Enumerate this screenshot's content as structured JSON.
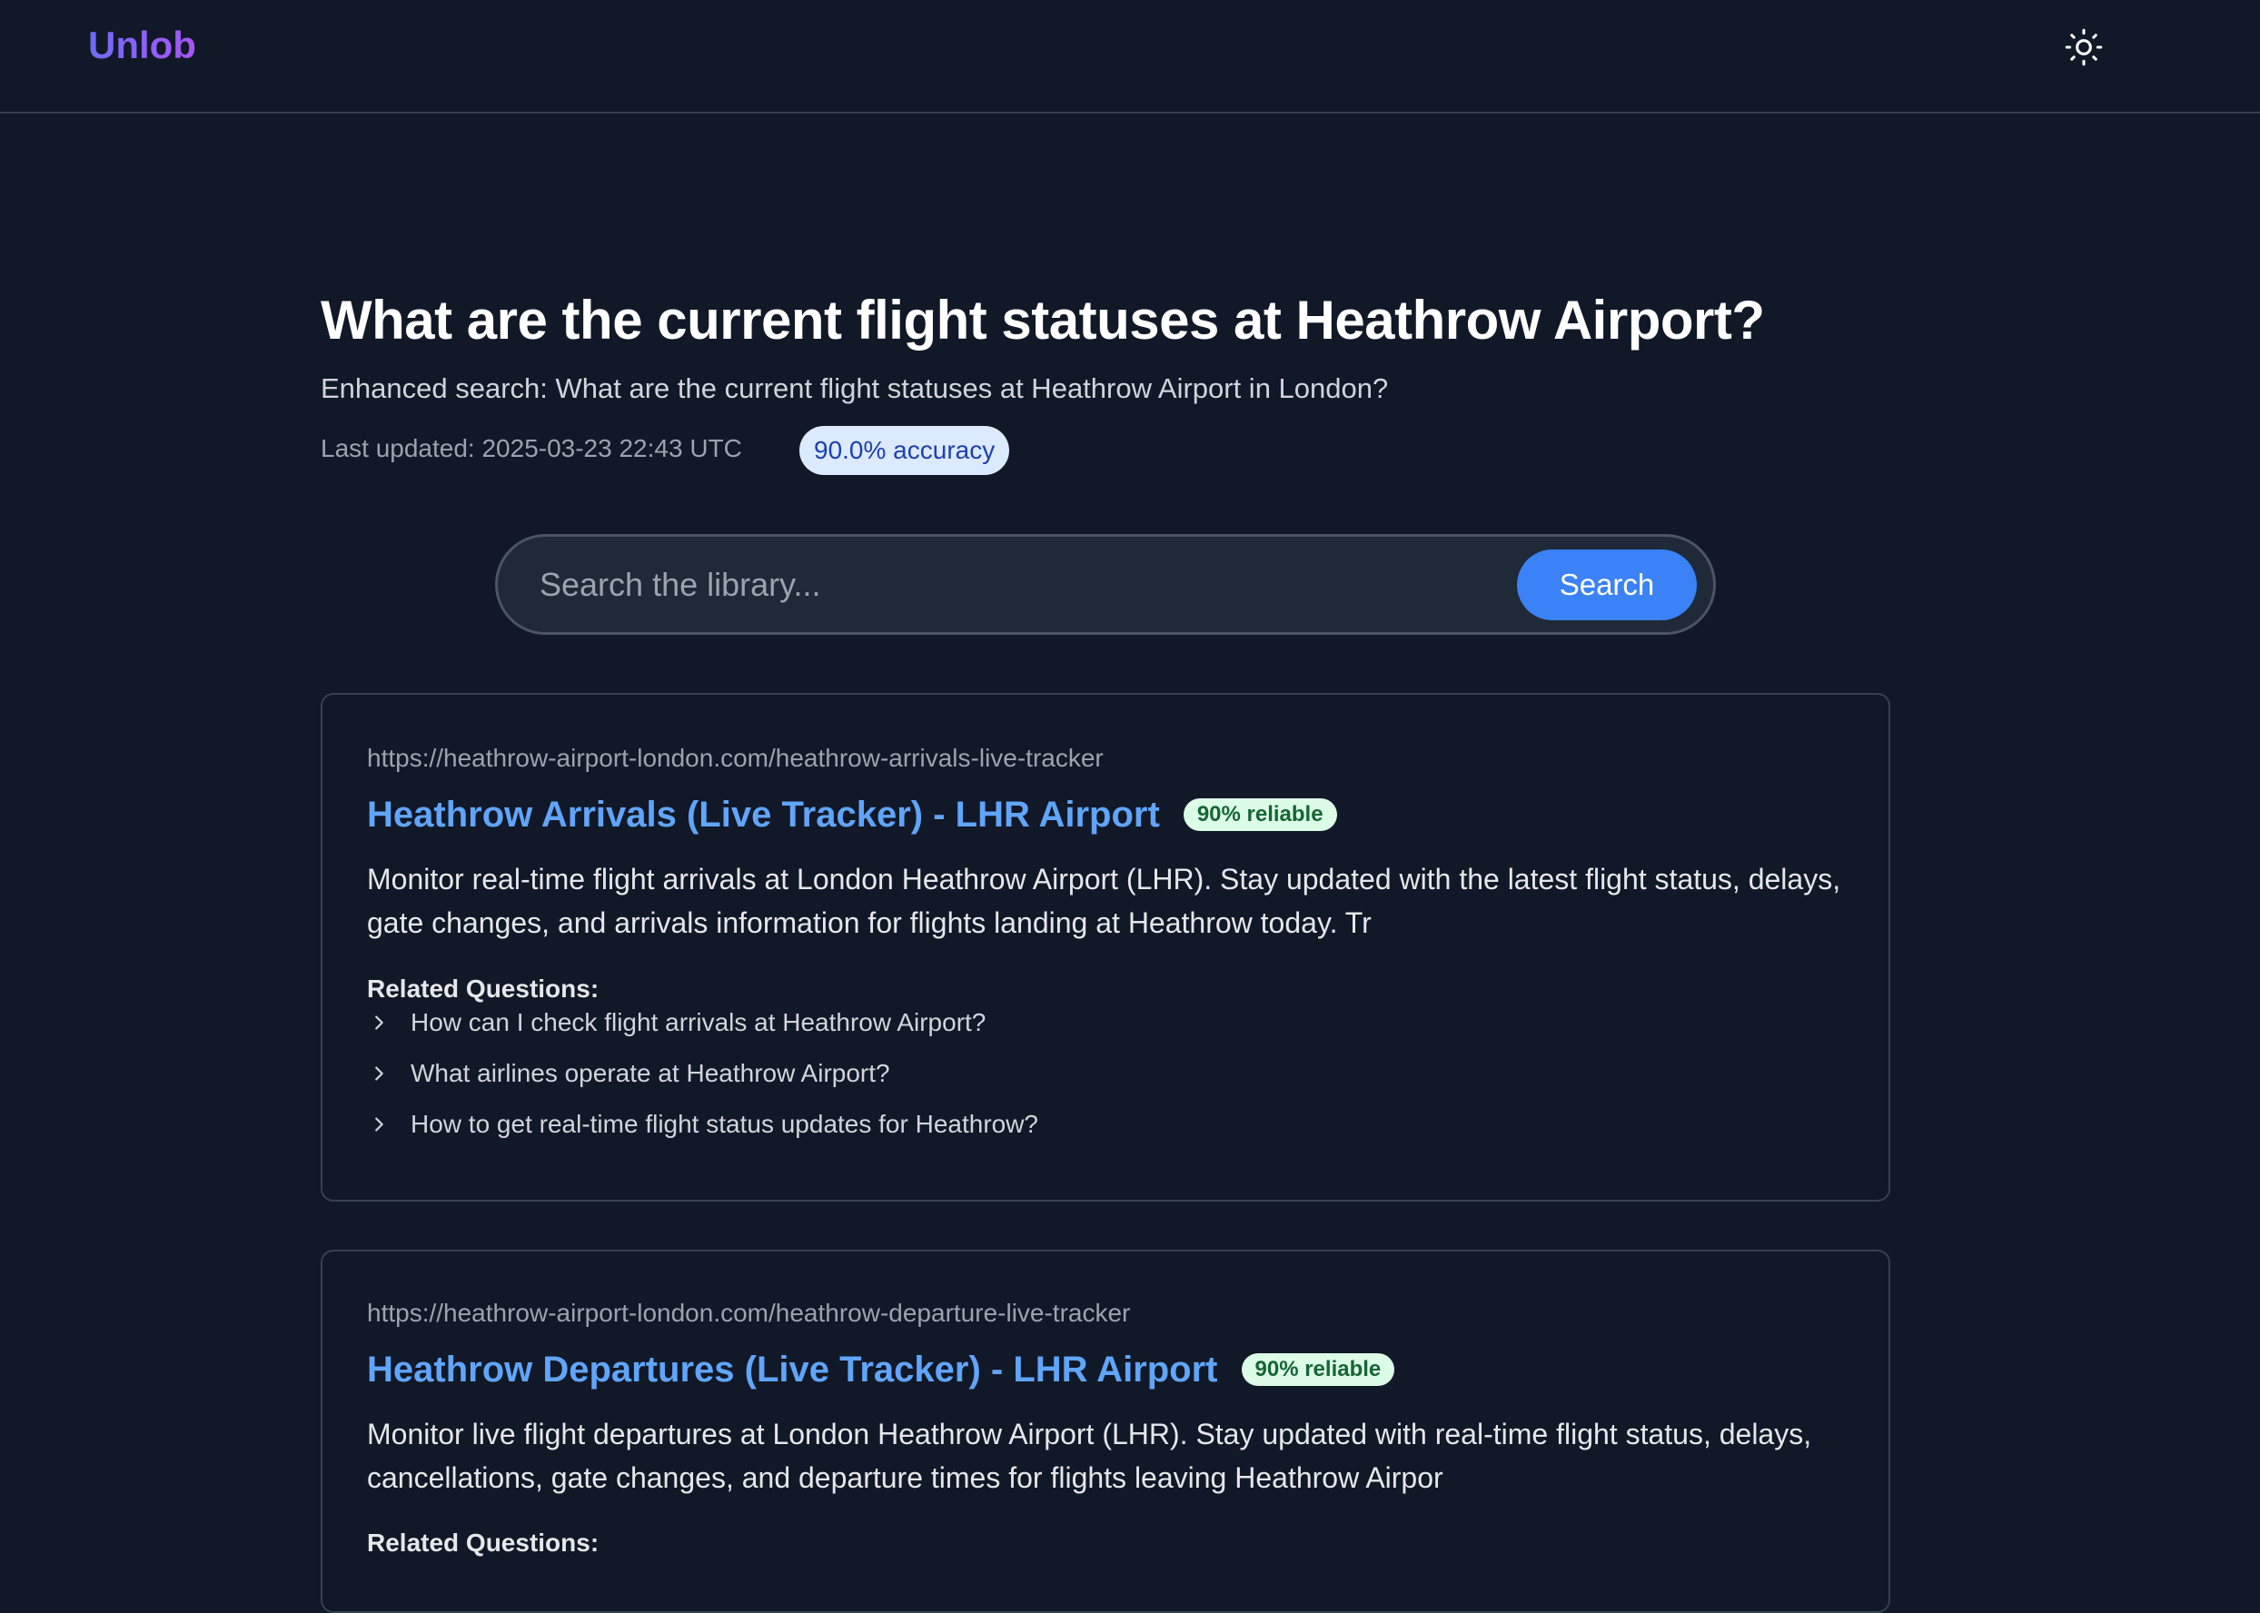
{
  "header": {
    "logo": "Unlob",
    "theme_icon": "sun-icon"
  },
  "query": {
    "title": "What are the current flight statuses at Heathrow Airport?",
    "enhanced": "Enhanced search: What are the current flight statuses at Heathrow Airport in London?",
    "last_updated": "Last updated: 2025-03-23 22:43 UTC",
    "accuracy": "90.0% accuracy"
  },
  "search": {
    "placeholder": "Search the library...",
    "button_label": "Search"
  },
  "results": [
    {
      "url": "https://heathrow-airport-london.com/heathrow-arrivals-live-tracker",
      "title": "Heathrow Arrivals (Live Tracker) - LHR Airport",
      "reliability": "90% reliable",
      "description": "Monitor real-time flight arrivals at London Heathrow Airport (LHR). Stay updated with the latest flight status, delays, gate changes, and arrivals information for flights landing at Heathrow today. Tr",
      "related_label": "Related Questions:",
      "related": [
        "How can I check flight arrivals at Heathrow Airport?",
        "What airlines operate at Heathrow Airport?",
        "How to get real-time flight status updates for Heathrow?"
      ]
    },
    {
      "url": "https://heathrow-airport-london.com/heathrow-departure-live-tracker",
      "title": "Heathrow Departures (Live Tracker) - LHR Airport",
      "reliability": "90% reliable",
      "description": "Monitor live flight departures at London Heathrow Airport (LHR). Stay updated with real-time flight status, delays, cancellations, gate changes, and departure times for flights leaving Heathrow Airpor",
      "related_label": "Related Questions:"
    }
  ],
  "colors": {
    "background": "#111827",
    "accent": "#3b82f6",
    "link": "#60a5fa",
    "badge_accuracy_bg": "#dbeafe",
    "badge_reliable_bg": "#dcfce7"
  }
}
